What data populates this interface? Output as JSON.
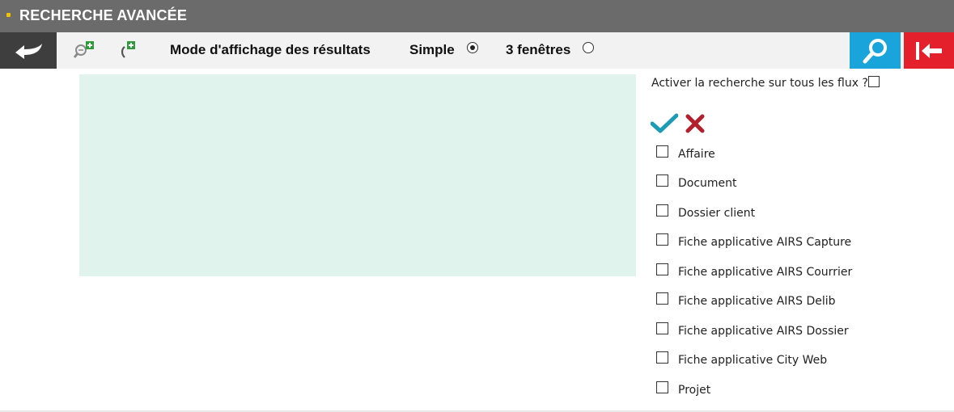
{
  "title": "RECHERCHE AVANCÉE",
  "toolbar": {
    "back_icon": "back-arrow-icon",
    "search_add_icon": "zoom-add-icon",
    "paren_add_icon": "parenthesis-add-icon",
    "mode_label": "Mode d'affichage des résultats",
    "options": [
      {
        "label": "Simple",
        "selected": true
      },
      {
        "label": "3 fenêtres",
        "selected": false
      }
    ],
    "search_icon": "magnifier-icon",
    "exit_icon": "exit-arrow-icon"
  },
  "flux": {
    "all_label": "Activer la recherche sur tous les flux ?",
    "all_checked": false,
    "items": [
      {
        "label": "Affaire",
        "checked": false
      },
      {
        "label": "Document",
        "checked": false
      },
      {
        "label": "Dossier client",
        "checked": false
      },
      {
        "label": "Fiche applicative AIRS Capture",
        "checked": false
      },
      {
        "label": "Fiche applicative AIRS Courrier",
        "checked": false
      },
      {
        "label": "Fiche applicative AIRS Delib",
        "checked": false
      },
      {
        "label": "Fiche applicative AIRS Dossier",
        "checked": false
      },
      {
        "label": "Fiche applicative City Web",
        "checked": false
      },
      {
        "label": "Projet",
        "checked": false
      }
    ]
  },
  "colors": {
    "title_bg": "#6b6b6b",
    "search_btn": "#19a5dc",
    "exit_btn": "#e5202d",
    "results_bg": "#e0f3ed",
    "check_color": "#1b9bb5",
    "cross_color": "#b3202b"
  }
}
